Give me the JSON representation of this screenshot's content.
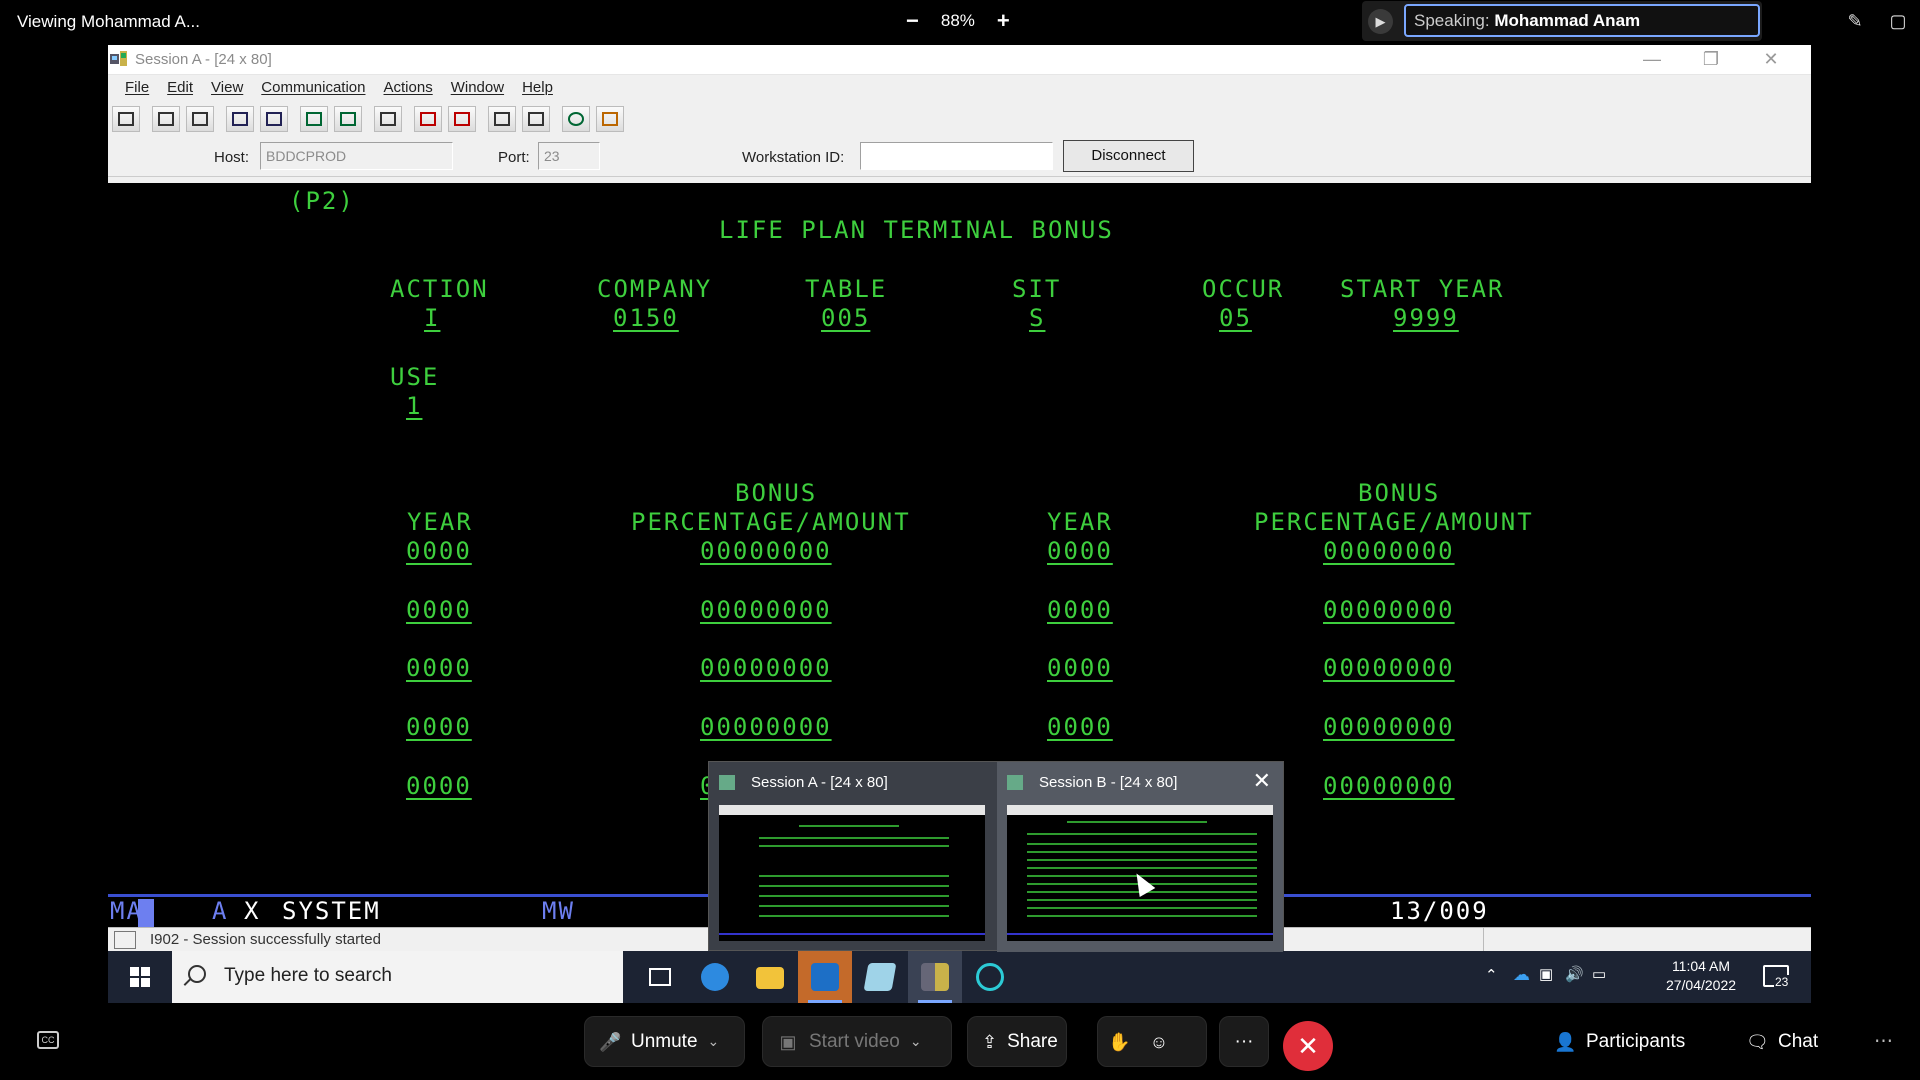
{
  "meeting": {
    "viewing": "Viewing Mohammad A...",
    "zoom_level": "88%",
    "zoom_out": "−",
    "zoom_in": "+",
    "speaking_label": "Speaking:",
    "speaking_name": "Mohammad Anam"
  },
  "window": {
    "title": "Session A - [24 x 80]",
    "menu": [
      "File",
      "Edit",
      "View",
      "Communication",
      "Actions",
      "Window",
      "Help"
    ],
    "host_label": "Host:",
    "host_value": "BDDCPROD",
    "port_label": "Port:",
    "port_value": "23",
    "workstation_label": "Workstation ID:",
    "workstation_value": "",
    "disconnect": "Disconnect"
  },
  "terminal": {
    "screen_id": "(P2)",
    "title": "LIFE PLAN TERMINAL BONUS",
    "headers": [
      "ACTION",
      "COMPANY",
      "TABLE",
      "SIT",
      "OCCUR",
      "START YEAR"
    ],
    "values": [
      "I",
      "0150",
      "005",
      "S",
      "05",
      "9999"
    ],
    "use_label": "USE",
    "use_value": "1",
    "bonus_label": "BONUS",
    "year_label": "YEAR",
    "pct_label": "PERCENTAGE/AMOUNT",
    "rows_left": [
      {
        "year": "0000",
        "amount": "00000000"
      },
      {
        "year": "0000",
        "amount": "00000000"
      },
      {
        "year": "0000",
        "amount": "00000000"
      },
      {
        "year": "0000",
        "amount": "00000000"
      },
      {
        "year": "0000",
        "amount": "0"
      }
    ],
    "rows_right": [
      {
        "year": "0000",
        "amount": "00000000"
      },
      {
        "year": "0000",
        "amount": "00000000"
      },
      {
        "year": "0000",
        "amount": "00000000"
      },
      {
        "year": "0000",
        "amount": "00000000"
      },
      {
        "year": "",
        "amount": "00000000"
      }
    ]
  },
  "oia": {
    "mode": "MA",
    "session": "A",
    "x": "X",
    "system": "SYSTEM",
    "mw": "MW",
    "position": "13/009"
  },
  "status": {
    "message": "I902 - Session successfully started"
  },
  "taskbar": {
    "search_placeholder": "Type here to search",
    "time": "11:04 AM",
    "date": "27/04/2022",
    "notifications": "23"
  },
  "previews": [
    {
      "title": "Session A - [24 x 80]"
    },
    {
      "title": "Session B - [24 x 80]",
      "close": "✕"
    }
  ],
  "controls": {
    "unmute": "Unmute",
    "start_video": "Start video",
    "share": "Share",
    "participants": "Participants",
    "chat": "Chat",
    "more": "···",
    "end": "✕"
  },
  "colors": {
    "terminal_text": "#3ecf3e",
    "oia_line": "#3a4fd0",
    "end_button": "#e02e3a",
    "speaker_border": "#7aa7ff"
  }
}
